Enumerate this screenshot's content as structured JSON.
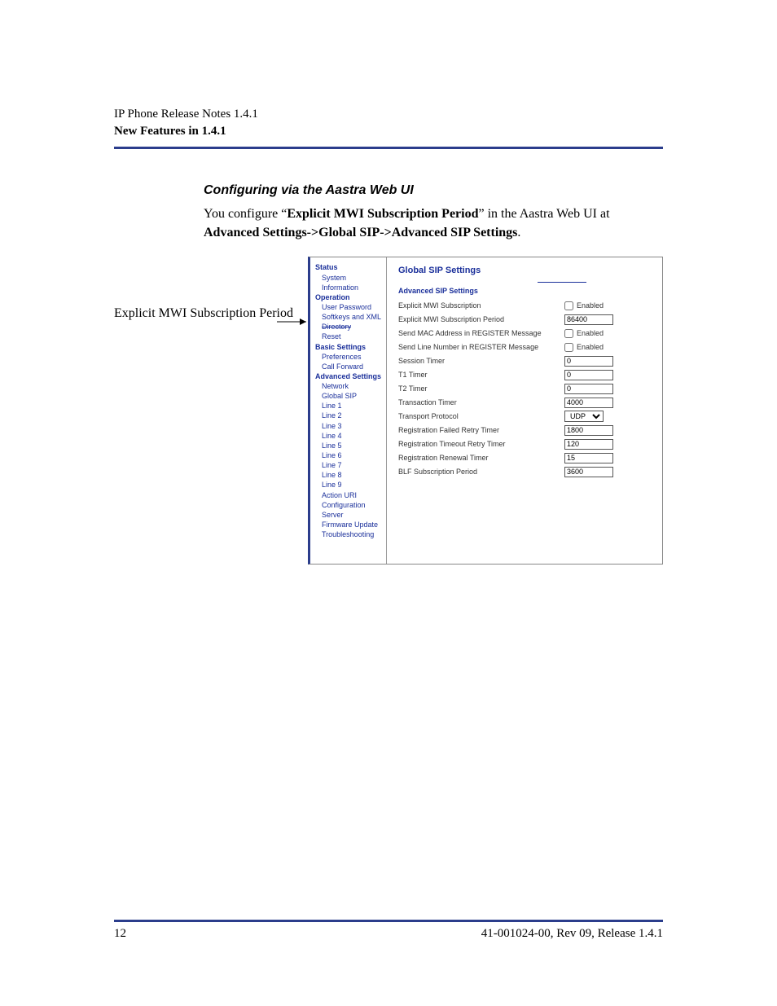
{
  "header": {
    "line1": "IP Phone Release Notes 1.4.1",
    "line2": "New Features in 1.4.1"
  },
  "section_title": "Configuring via the Aastra Web UI",
  "body": {
    "p1a": "You configure “",
    "p1b": "Explicit MWI Subscription Period",
    "p1c": "” in the Aastra Web UI at ",
    "p2": "Advanced Settings->Global SIP->Advanced SIP Settings",
    "p2end": "."
  },
  "callout": "Explicit MWI Subscription Period",
  "nav": {
    "status_hdr": "Status",
    "sys_info": "System Information",
    "operation_hdr": "Operation",
    "user_password": "User Password",
    "softkeys": "Softkeys and XML",
    "directory": "Directory",
    "reset": "Reset",
    "basic_hdr": "Basic Settings",
    "preferences": "Preferences",
    "call_forward": "Call Forward",
    "advanced_hdr": "Advanced Settings",
    "network": "Network",
    "global_sip": "Global SIP",
    "line1": "Line 1",
    "line2": "Line 2",
    "line3": "Line 3",
    "line4": "Line 4",
    "line5": "Line 5",
    "line6": "Line 6",
    "line7": "Line 7",
    "line8": "Line 8",
    "line9": "Line 9",
    "action_uri": "Action URI",
    "config_server": "Configuration Server",
    "firmware": "Firmware Update",
    "troubleshoot": "Troubleshooting"
  },
  "panel": {
    "title": "Global SIP Settings",
    "subtitle": "Advanced SIP Settings",
    "rows": {
      "r1": "Explicit MWI Subscription",
      "r2": "Explicit MWI Subscription Period",
      "r3": "Send MAC Address in REGISTER Message",
      "r4": "Send Line Number in REGISTER Message",
      "r5": "Session Timer",
      "r6": "T1 Timer",
      "r7": "T2 Timer",
      "r8": "Transaction Timer",
      "r9": "Transport Protocol",
      "r10": "Registration Failed Retry Timer",
      "r11": "Registration Timeout Retry Timer",
      "r12": "Registration Renewal Timer",
      "r13": "BLF Subscription Period"
    },
    "values": {
      "enabled_label": "Enabled",
      "v2": "86400",
      "v5": "0",
      "v6": "0",
      "v7": "0",
      "v8": "4000",
      "v9": "UDP",
      "v10": "1800",
      "v11": "120",
      "v12": "15",
      "v13": "3600"
    }
  },
  "footer": {
    "page": "12",
    "right": "41-001024-00, Rev 09, Release 1.4.1"
  }
}
